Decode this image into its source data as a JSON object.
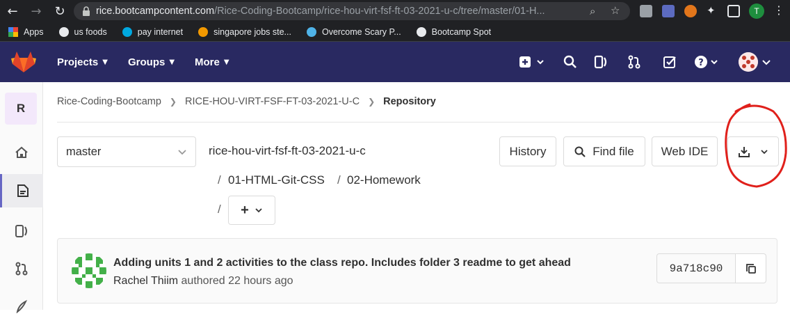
{
  "browser": {
    "url_host": "rice.bootcampcontent.com",
    "url_path": "/Rice-Coding-Bootcamp/rice-hou-virt-fsf-ft-03-2021-u-c/tree/master/01-H...",
    "profile_initial": "T"
  },
  "bookmarks": [
    {
      "label": "Apps",
      "icon": "apps-grid-icon"
    },
    {
      "label": "us foods",
      "icon": "globe-icon"
    },
    {
      "label": "pay internet",
      "icon": "att-icon"
    },
    {
      "label": "singapore jobs ste...",
      "icon": "jobs-icon"
    },
    {
      "label": "Overcome Scary P...",
      "icon": "m-icon"
    },
    {
      "label": "Bootcamp Spot",
      "icon": "globe-icon"
    }
  ],
  "header": {
    "nav": [
      "Projects",
      "Groups",
      "More"
    ]
  },
  "sidebar": {
    "project_initial": "R"
  },
  "breadcrumb": [
    "Rice-Coding-Bootcamp",
    "RICE-HOU-VIRT-FSF-FT-03-2021-U-C",
    "Repository"
  ],
  "repo": {
    "branch": "master",
    "path_root": "rice-hou-virt-fsf-ft-03-2021-u-c",
    "path_segments": [
      "01-HTML-Git-CSS",
      "02-Homework"
    ],
    "slash": "/",
    "add_label": "+"
  },
  "toolbar": {
    "history": "History",
    "find_file": "Find file",
    "web_ide": "Web IDE"
  },
  "commit": {
    "title": "Adding units 1 and 2 activities to the class repo. Includes folder 3 readme to get ahead",
    "author": "Rachel Thiim",
    "meta": "authored 22 hours ago",
    "sha": "9a718c90"
  },
  "colors": {
    "header": "#292961",
    "annotation": "#e0201b",
    "sidebar_active": "#6666c4"
  }
}
